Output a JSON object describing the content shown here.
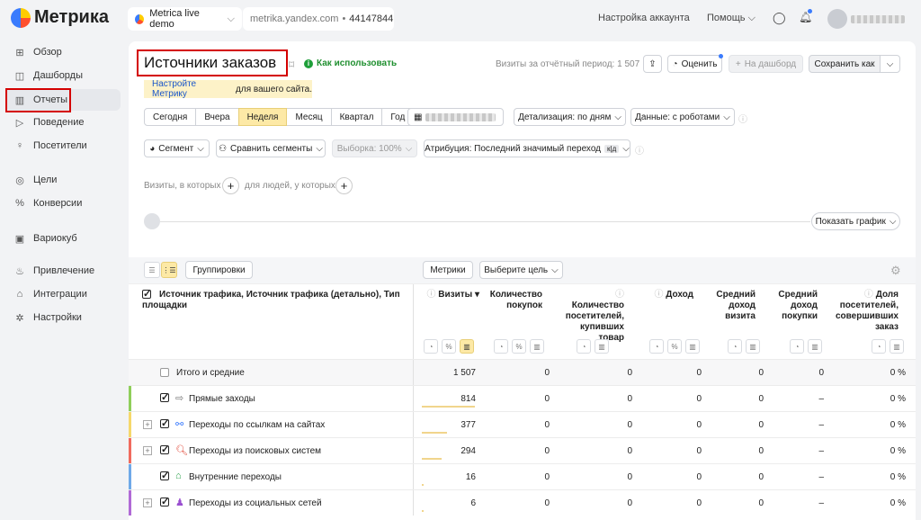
{
  "app": {
    "logo_text": "Метрика"
  },
  "topbar": {
    "counter_name": "Metrica live demo",
    "site": "metrika.yandex.com",
    "counter_id": "44147844",
    "account_settings": "Настройка аккаунта",
    "help": "Помощь"
  },
  "sidebar": {
    "items": [
      {
        "label": "Обзор",
        "icon": "grid-icon"
      },
      {
        "label": "Дашборды",
        "icon": "dashboard-icon"
      },
      {
        "label": "Отчеты",
        "icon": "bar-chart-icon",
        "active": true
      },
      {
        "label": "Поведение",
        "icon": "play-icon"
      },
      {
        "label": "Посетители",
        "icon": "user-icon"
      },
      {
        "label": "Цели",
        "icon": "target-icon"
      },
      {
        "label": "Конверсии",
        "icon": "percent-icon"
      },
      {
        "label": "Вариокуб",
        "icon": "cube-icon"
      },
      {
        "label": "Привлечение",
        "icon": "flame-icon"
      },
      {
        "label": "Интеграции",
        "icon": "puzzle-icon"
      },
      {
        "label": "Настройки",
        "icon": "gear-icon"
      }
    ]
  },
  "report": {
    "title": "Источники заказов",
    "how_to_use": "Как использовать",
    "visits_period": "Визиты за отчётный период: 1 507",
    "rate": "Оценить",
    "to_dashboard": "На дашборд",
    "save_as": "Сохранить как",
    "setup_link": "Настройте Метрику",
    "setup_rest": " для вашего сайта."
  },
  "period": {
    "options": [
      "Сегодня",
      "Вчера",
      "Неделя",
      "Месяц",
      "Квартал",
      "Год"
    ],
    "selected": "Неделя"
  },
  "filters": {
    "detail": "Детализация: по дням",
    "data": "Данные: с роботами",
    "segment": "Сегмент",
    "compare": "Сравнить сегменты",
    "sample": "Выборка: 100%",
    "attribution": "Атрибуция: Последний значимый переход",
    "attribution_badge": "к|д",
    "visits_where": "Визиты, в которых",
    "people_where": "для людей, у которых",
    "show_chart": "Показать график"
  },
  "table": {
    "groupings": "Группировки",
    "metrics": "Метрики",
    "choose_goal": "Выберите цель",
    "dimension_header": "Источник трафика, Источник трафика (детально), Тип площадки",
    "columns": [
      "Визиты",
      "Количество покупок",
      "Количество посетителей, купивших товар",
      "Доход",
      "Средний доход визита",
      "Средний доход покупки",
      "Доля посетителей, совершивших заказ"
    ],
    "total_label": "Итого и средние",
    "total": [
      "1 507",
      "0",
      "0",
      "0",
      "0",
      "0",
      "0 %"
    ],
    "rows": [
      {
        "label": "Прямые заходы",
        "values": [
          "814",
          "0",
          "0",
          "0",
          "0",
          "–",
          "0 %"
        ],
        "visit_share": 0.54,
        "color": "#8fce5a",
        "icon": "door-icon"
      },
      {
        "label": "Переходы по ссылкам на сайтах",
        "values": [
          "377",
          "0",
          "0",
          "0",
          "0",
          "–",
          "0 %"
        ],
        "visit_share": 0.25,
        "color": "#f6d86b",
        "icon": "link-icon"
      },
      {
        "label": "Переходы из поисковых систем",
        "values": [
          "294",
          "0",
          "0",
          "0",
          "0",
          "–",
          "0 %"
        ],
        "visit_share": 0.2,
        "color": "#f06b5e",
        "icon": "search-icon"
      },
      {
        "label": "Внутренние переходы",
        "values": [
          "16",
          "0",
          "0",
          "0",
          "0",
          "–",
          "0 %"
        ],
        "visit_share": 0.01,
        "color": "#6fa9e8",
        "icon": "home-icon"
      },
      {
        "label": "Переходы из социальных сетей",
        "values": [
          "6",
          "0",
          "0",
          "0",
          "0",
          "–",
          "0 %"
        ],
        "visit_share": 0.004,
        "color": "#b06ad6",
        "icon": "person-icon"
      }
    ]
  },
  "colors": {
    "accent_yellow": "#fde9a6",
    "highlight_red": "#d40000",
    "link_blue": "#1a56c9"
  }
}
